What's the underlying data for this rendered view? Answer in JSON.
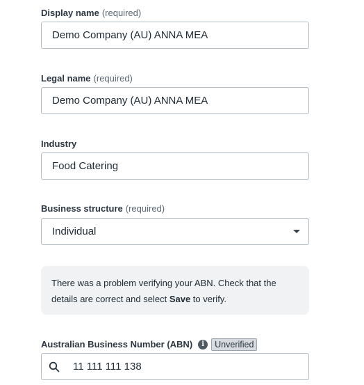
{
  "display_name": {
    "label": "Display name",
    "required_text": "(required)",
    "value": "Demo Company (AU) ANNA MEA"
  },
  "legal_name": {
    "label": "Legal name",
    "required_text": "(required)",
    "value": "Demo Company (AU) ANNA MEA"
  },
  "industry": {
    "label": "Industry",
    "value": "Food Catering"
  },
  "business_structure": {
    "label": "Business structure",
    "required_text": "(required)",
    "selected": "Individual"
  },
  "notice": {
    "text_before": "There was a problem verifying your ABN. Check that the details are correct and select ",
    "bold": "Save",
    "text_after": " to verify."
  },
  "abn": {
    "label": "Australian Business Number (ABN)",
    "info_icon": "info-icon",
    "badge": "Unverified",
    "search_icon": "search-icon",
    "value": "11 111 111 138"
  },
  "colors": {
    "field_border": "#b4bcc3",
    "notice_bg": "#f0f2f4",
    "badge_bg": "#d7dbdf",
    "text": "#1f2a33"
  }
}
